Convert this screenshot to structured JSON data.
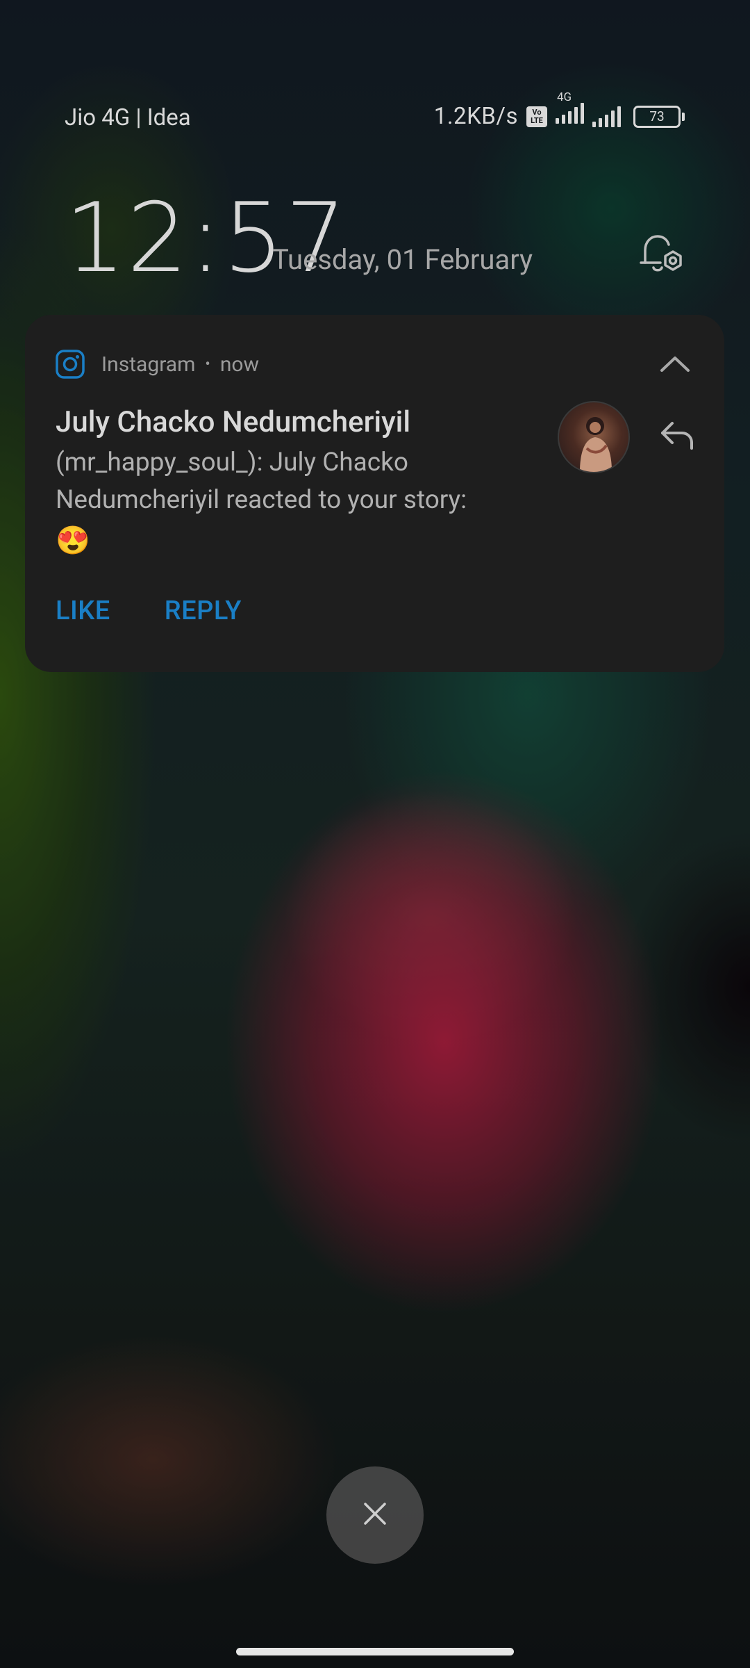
{
  "status_bar": {
    "carrier": "Jio 4G | Idea",
    "network_speed": "1.2KB/s",
    "volte_top": "Vo",
    "volte_bottom": "LTE",
    "signal_label": "4G",
    "battery": "73"
  },
  "lock_screen": {
    "time": "12:57",
    "date": "Tuesday, 01 February"
  },
  "notification": {
    "app_name": "Instagram",
    "separator": "•",
    "time": "now",
    "title": "July Chacko Nedumcheriyil",
    "body": "(mr_happy_soul_): July Chacko Nedumcheriyil reacted to your story:",
    "emoji": "😍",
    "actions": [
      "LIKE",
      "REPLY"
    ],
    "accent_color": "#1a7fc6"
  },
  "icons": {
    "app": "instagram-icon",
    "collapse": "chevron-up-icon",
    "reply": "reply-icon",
    "lockscreen_settings": "bell-settings-icon",
    "dismiss": "close-icon"
  }
}
